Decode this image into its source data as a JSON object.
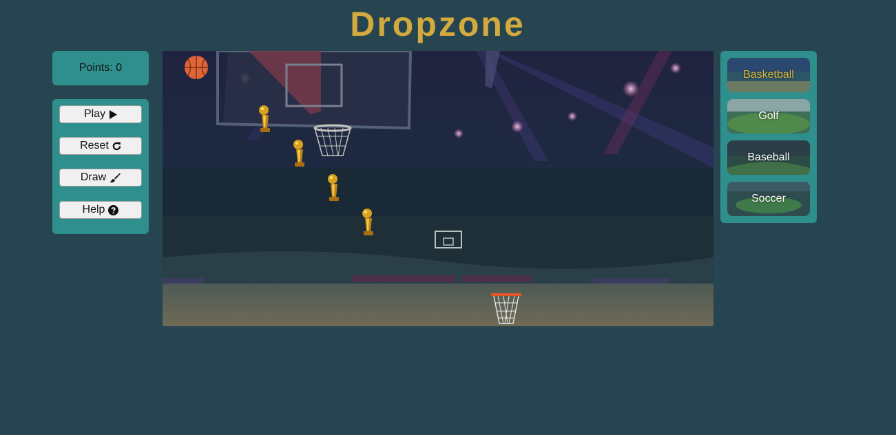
{
  "header": {
    "title": "Dropzone"
  },
  "score": {
    "text": "Points: 0"
  },
  "controls": {
    "play_label": "Play",
    "play_icon": "play-icon",
    "reset_label": "Reset",
    "reset_icon": "refresh-icon",
    "draw_label": "Draw",
    "draw_icon": "paintbrush-icon",
    "help_label": "Help",
    "help_icon": "question-circle-icon"
  },
  "game": {
    "background_theme": "basketball arena",
    "ball_icon": "basketball-icon",
    "obstacle_icon": "trophy-icon",
    "goal_icon": "hoop-icon"
  },
  "themes": {
    "items": [
      {
        "label": "Basketball",
        "selected": true
      },
      {
        "label": "Golf",
        "selected": false
      },
      {
        "label": "Baseball",
        "selected": false
      },
      {
        "label": "Soccer",
        "selected": false
      }
    ]
  },
  "colors": {
    "page_background": "#274451",
    "panel": "#2f8f8c",
    "title": "#d3aa3e",
    "selected_theme_text": "#e0b640",
    "button": "#f0f0f0"
  }
}
